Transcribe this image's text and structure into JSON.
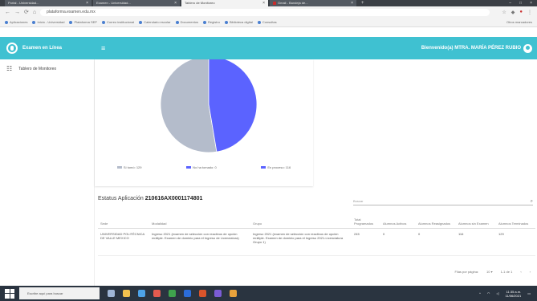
{
  "browser": {
    "tabs": [
      {
        "label": "Portal - Universidad...",
        "active": false
      },
      {
        "label": "Examen - Universidad...",
        "active": false
      },
      {
        "label": "Tablero de Monitoreo",
        "active": true
      },
      {
        "label": "Gmail - Bandeja de...",
        "active": false
      }
    ],
    "url": "plataforma.examen.edu.mx",
    "bookmarks": [
      "Aplicaciones",
      "Inicio - Universidad",
      "Plataforma SEP",
      "Correo institucional",
      "Calendario escolar",
      "Documentos",
      "Registro",
      "Biblioteca digital",
      "Consultas"
    ],
    "bookmarks_right": "Otros marcadores"
  },
  "header": {
    "brand": "Examen en Línea",
    "welcome": "Bienvenido(a) MTRA. MARÍA PÉREZ RUBIO"
  },
  "sidebar": {
    "items": [
      {
        "label": "Tablero de Monitoreo"
      }
    ]
  },
  "chart_data": {
    "type": "pie",
    "categories": [
      "Sí tomó",
      "No ha tomado",
      "En proceso"
    ],
    "values": [
      129,
      0,
      116
    ],
    "colors": [
      "#b4bccb",
      "#5b63ff",
      "#5b63ff"
    ],
    "legend": [
      "Sí tomó: 129",
      "No ha tomado: 0",
      "En proceso: 116"
    ]
  },
  "panel": {
    "title_prefix": "Estatus Aplicación",
    "title_code": "210616AX0001174801",
    "search_placeholder": "Buscar",
    "columns": [
      "Sede",
      "Modalidad",
      "Grupo",
      "Total Programados",
      "Alumnos Activos",
      "Alumnos Reasignados",
      "Alumnos sin Examen",
      "Alumnos Terminados"
    ],
    "rows": [
      [
        "UNIVERSIDAD POLITÉCNICA DE VALLE MEXICO",
        "Ingreso 2021 (examen de selección con reactivos de opción múltiple. Examen de dominio para el Ingreso de Licenciatura)",
        "Ingreso 2021 (examen de selección con reactivos de opción múltiple. Examen de dominio para el Ingreso 2021-Licenciatura Grupo 1)",
        "245",
        "0",
        "0",
        "116",
        "129"
      ]
    ],
    "pager": {
      "rows_label": "Filas por página:",
      "rows_value": "10",
      "range": "1-1 de 1"
    }
  },
  "taskbar": {
    "search": "Escribe aquí para buscar",
    "time": "11:35 a.m.",
    "date": "11/06/2021"
  }
}
